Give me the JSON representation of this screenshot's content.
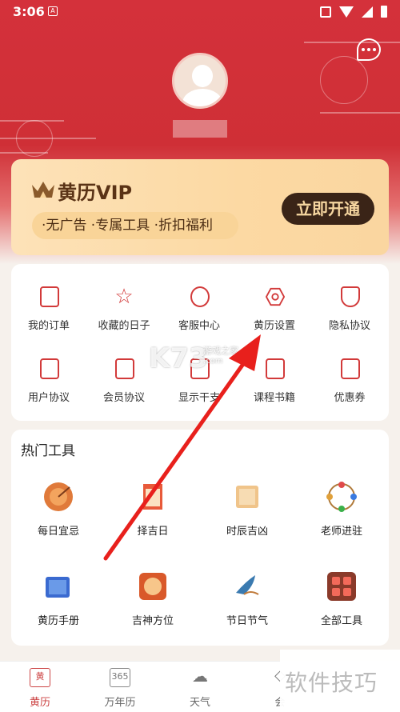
{
  "status": {
    "time": "3:06",
    "badge": "A"
  },
  "user": {
    "name": ""
  },
  "vip": {
    "title": "黄历VIP",
    "benefits": "·无广告 ·专属工具 ·折扣福利",
    "button": "立即开通"
  },
  "menu": [
    {
      "label": "我的订单",
      "icon": "order-icon"
    },
    {
      "label": "收藏的日子",
      "icon": "star-icon"
    },
    {
      "label": "客服中心",
      "icon": "headset-icon"
    },
    {
      "label": "黄历设置",
      "icon": "settings-icon"
    },
    {
      "label": "隐私协议",
      "icon": "shield-icon"
    },
    {
      "label": "用户协议",
      "icon": "document-icon"
    },
    {
      "label": "会员协议",
      "icon": "crown-doc-icon"
    },
    {
      "label": "显示干支",
      "icon": "calendar-icon"
    },
    {
      "label": "课程书籍",
      "icon": "book-icon"
    },
    {
      "label": "优惠券",
      "icon": "coupon-icon"
    }
  ],
  "tools": {
    "title": "热门工具",
    "items": [
      {
        "label": "每日宜忌",
        "icon": "compass-icon"
      },
      {
        "label": "择吉日",
        "icon": "calendar-icon"
      },
      {
        "label": "时辰吉凶",
        "icon": "scroll-icon"
      },
      {
        "label": "老师进驻",
        "icon": "bagua-icon"
      },
      {
        "label": "黄历手册",
        "icon": "handbook-icon"
      },
      {
        "label": "吉神方位",
        "icon": "luopan-icon"
      },
      {
        "label": "节日节气",
        "icon": "bird-icon"
      },
      {
        "label": "全部工具",
        "icon": "grid-icon"
      }
    ]
  },
  "nav": [
    {
      "label": "黄历",
      "glyph": "黄"
    },
    {
      "label": "万年历",
      "glyph": "365"
    },
    {
      "label": "天气",
      "glyph": "☁"
    },
    {
      "label": "会",
      "glyph": "◇"
    }
  ],
  "watermarks": {
    "k73": "K73",
    "k73_sub": "游戏之家",
    "k73_url": ".com",
    "corner": "软件技巧"
  },
  "colors": {
    "primary": "#d4313b",
    "vip_dark": "#3a2417",
    "icon_red": "#d23a3a"
  }
}
